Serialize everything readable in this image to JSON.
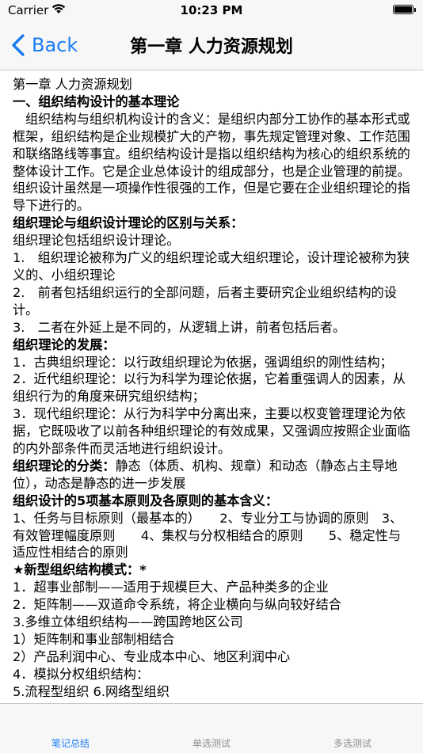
{
  "status_bar": {
    "carrier": "Carrier",
    "time": "10:23 PM"
  },
  "nav": {
    "back_label": "Back",
    "title": "第一章 人力资源规划"
  },
  "content": {
    "lines": [
      {
        "text": "第一章 人力资源规划",
        "bold": false
      },
      {
        "text": "一、组织结构设计的基本理论",
        "bold": true
      },
      {
        "text": "组织结构与组织机构设计的含义：是组织内部分工协作的基本形式或框架，组织结构是企业规模扩大的产物，事先规定管理对象、工作范围和联络路线等事宜。组织结构设计是指以组织结构为核心的组织系统的整体设计工作。它是企业总体设计的组成部分，也是企业管理的前提。组织设计虽然是一项操作性很强的工作，但是它要在企业组织理论的指导下进行的。",
        "bold": false,
        "indent": true
      },
      {
        "text": "组织理论与组织设计理论的区别与关系：",
        "bold": true
      },
      {
        "text": "组织理论包括组织设计理论。",
        "bold": false
      },
      {
        "text": "1.　组织理论被称为广义的组织理论或大组织理论，设计理论被称为狭义的、小组织理论",
        "bold": false
      },
      {
        "text": "2.　前者包括组织运行的全部问题，后者主要研究企业组织结构的设计。",
        "bold": false
      },
      {
        "text": "3.　二者在外延上是不同的，从逻辑上讲，前者包括后者。",
        "bold": false
      },
      {
        "text": "组织理论的发展：",
        "bold": true
      },
      {
        "text": "1．古典组织理论：以行政组织理论为依据，强调组织的刚性结构；",
        "bold": false
      },
      {
        "text": "2．近代组织理论：以行为科学为理论依据，它着重强调人的因素，从组织行为的角度来研究组织结构；",
        "bold": false
      },
      {
        "text": "3．现代组织理论：从行为科学中分离出来，主要以权变管理理论为依据，它既吸收了以前各种组织理论的有效成果，又强调应按照企业面临的内外部条件而灵活地进行组织设计。",
        "bold": false
      },
      {
        "text_bold": "组织理论的分类：",
        "text": "静态（体质、机构、规章）和动态（静态占主导地位），动态是静态的进一步发展",
        "mixed": true
      },
      {
        "text": "组织设计的5项基本原则及各原则的基本含义：",
        "bold": true
      },
      {
        "text": "1、任务与目标原则（最基本的）　　2、专业分工与协调的原则　3、有效管理幅度原则　　4、集权与分权相结合的原则　　5、稳定性与适应性相结合的原则",
        "bold": false
      },
      {
        "text": "★新型组织结构模式：*",
        "bold": true
      },
      {
        "text": "1．超事业部制——适用于规模巨大、产品种类多的企业",
        "bold": false
      },
      {
        "text": "2．矩阵制——双道命令系统，将企业横向与纵向较好结合",
        "bold": false
      },
      {
        "text": "3.多维立体组织结构——跨国跨地区公司",
        "bold": false
      },
      {
        "text": "1）矩阵制和事业部制相结合",
        "bold": false
      },
      {
        "text": "2）产品利润中心、专业成本中心、地区利润中心",
        "bold": false
      },
      {
        "text": "4．模拟分权组织结构：",
        "bold": false
      },
      {
        "text": "5.流程型组织 6.网络型组织",
        "bold": false
      }
    ]
  },
  "tabs": [
    {
      "label": "笔记总结",
      "active": true
    },
    {
      "label": "单选测试",
      "active": false
    },
    {
      "label": "多选测试",
      "active": false
    }
  ],
  "colors": {
    "accent": "#1a7cf2",
    "inactive": "#8e8e93",
    "bar_bg": "#f7f7f7"
  },
  "icons": {
    "back": "chevron-left-icon",
    "wifi": "wifi-icon",
    "battery": "battery-icon"
  }
}
